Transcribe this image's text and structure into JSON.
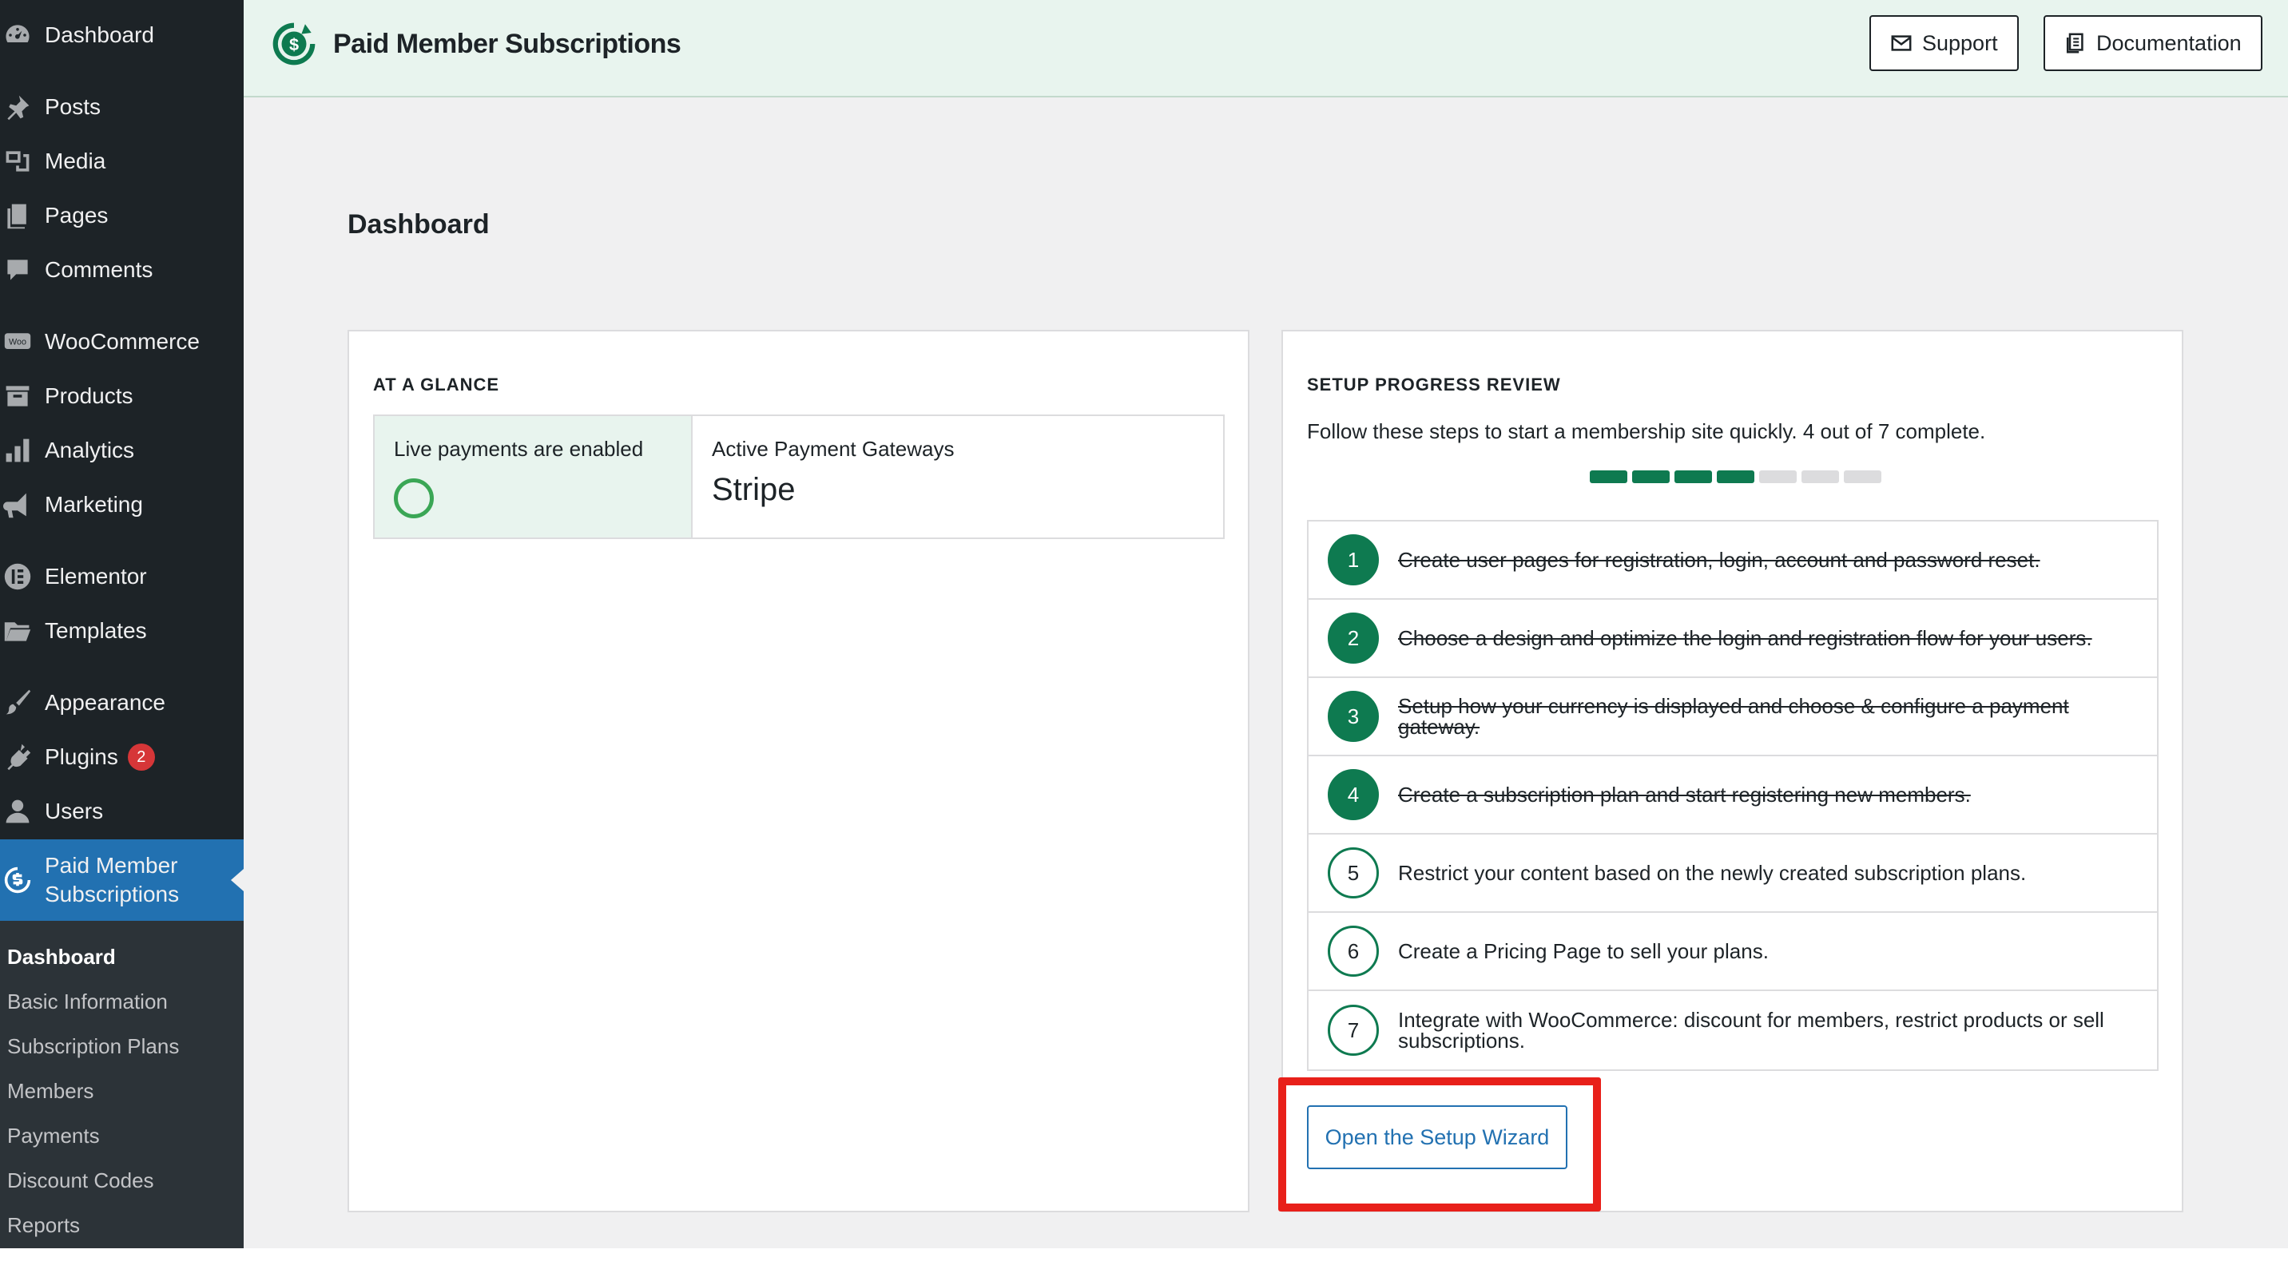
{
  "sidebar": {
    "items": [
      {
        "label": "Dashboard",
        "icon": "dashboard-icon"
      },
      {
        "label": "Posts",
        "icon": "pin-icon"
      },
      {
        "label": "Media",
        "icon": "media-icon"
      },
      {
        "label": "Pages",
        "icon": "pages-icon"
      },
      {
        "label": "Comments",
        "icon": "comments-icon"
      },
      {
        "label": "WooCommerce",
        "icon": "woocommerce-icon"
      },
      {
        "label": "Products",
        "icon": "archive-icon"
      },
      {
        "label": "Analytics",
        "icon": "bar-chart-icon"
      },
      {
        "label": "Marketing",
        "icon": "megaphone-icon"
      },
      {
        "label": "Elementor",
        "icon": "elementor-icon"
      },
      {
        "label": "Templates",
        "icon": "folder-icon"
      },
      {
        "label": "Appearance",
        "icon": "paintbrush-icon"
      },
      {
        "label": "Plugins",
        "icon": "plugin-icon",
        "badge": "2"
      },
      {
        "label": "Users",
        "icon": "user-icon"
      },
      {
        "label_line1": "Paid Member",
        "label_line2": "Subscriptions",
        "icon": "pms-icon"
      }
    ],
    "submenu": [
      "Dashboard",
      "Basic Information",
      "Subscription Plans",
      "Members",
      "Payments",
      "Discount Codes",
      "Reports"
    ]
  },
  "header": {
    "title": "Paid Member Subscriptions",
    "support_label": "Support",
    "docs_label": "Documentation"
  },
  "page": {
    "title": "Dashboard"
  },
  "glance": {
    "heading": "AT A GLANCE",
    "live_label": "Live payments are enabled",
    "gateways_label": "Active Payment Gateways",
    "gateways_value": "Stripe"
  },
  "progress": {
    "heading": "SETUP PROGRESS REVIEW",
    "intro": "Follow these steps to start a membership site quickly. 4 out of 7 complete.",
    "completed": 4,
    "total": 7,
    "steps": [
      {
        "num": "1",
        "text": "Create user pages for registration, login, account and password reset.",
        "done": true
      },
      {
        "num": "2",
        "text": "Choose a design and optimize the login and registration flow for your users.",
        "done": true
      },
      {
        "num": "3",
        "text": "Setup how your currency is displayed and choose & configure a payment gateway.",
        "done": true
      },
      {
        "num": "4",
        "text": "Create a subscription plan and start registering new members.",
        "done": true
      },
      {
        "num": "5",
        "text": "Restrict your content based on the newly created subscription plans.",
        "done": false
      },
      {
        "num": "6",
        "text": "Create a Pricing Page to sell your plans.",
        "done": false
      },
      {
        "num": "7",
        "text": "Integrate with WooCommerce: discount for members, restrict products or sell subscriptions.",
        "done": false
      }
    ],
    "wizard_label": "Open the Setup Wizard"
  },
  "colors": {
    "sidebar_bg": "#1d2327",
    "active_blue": "#2271b1",
    "brand_green": "#0e7a50",
    "highlight_red": "#e8201a"
  }
}
